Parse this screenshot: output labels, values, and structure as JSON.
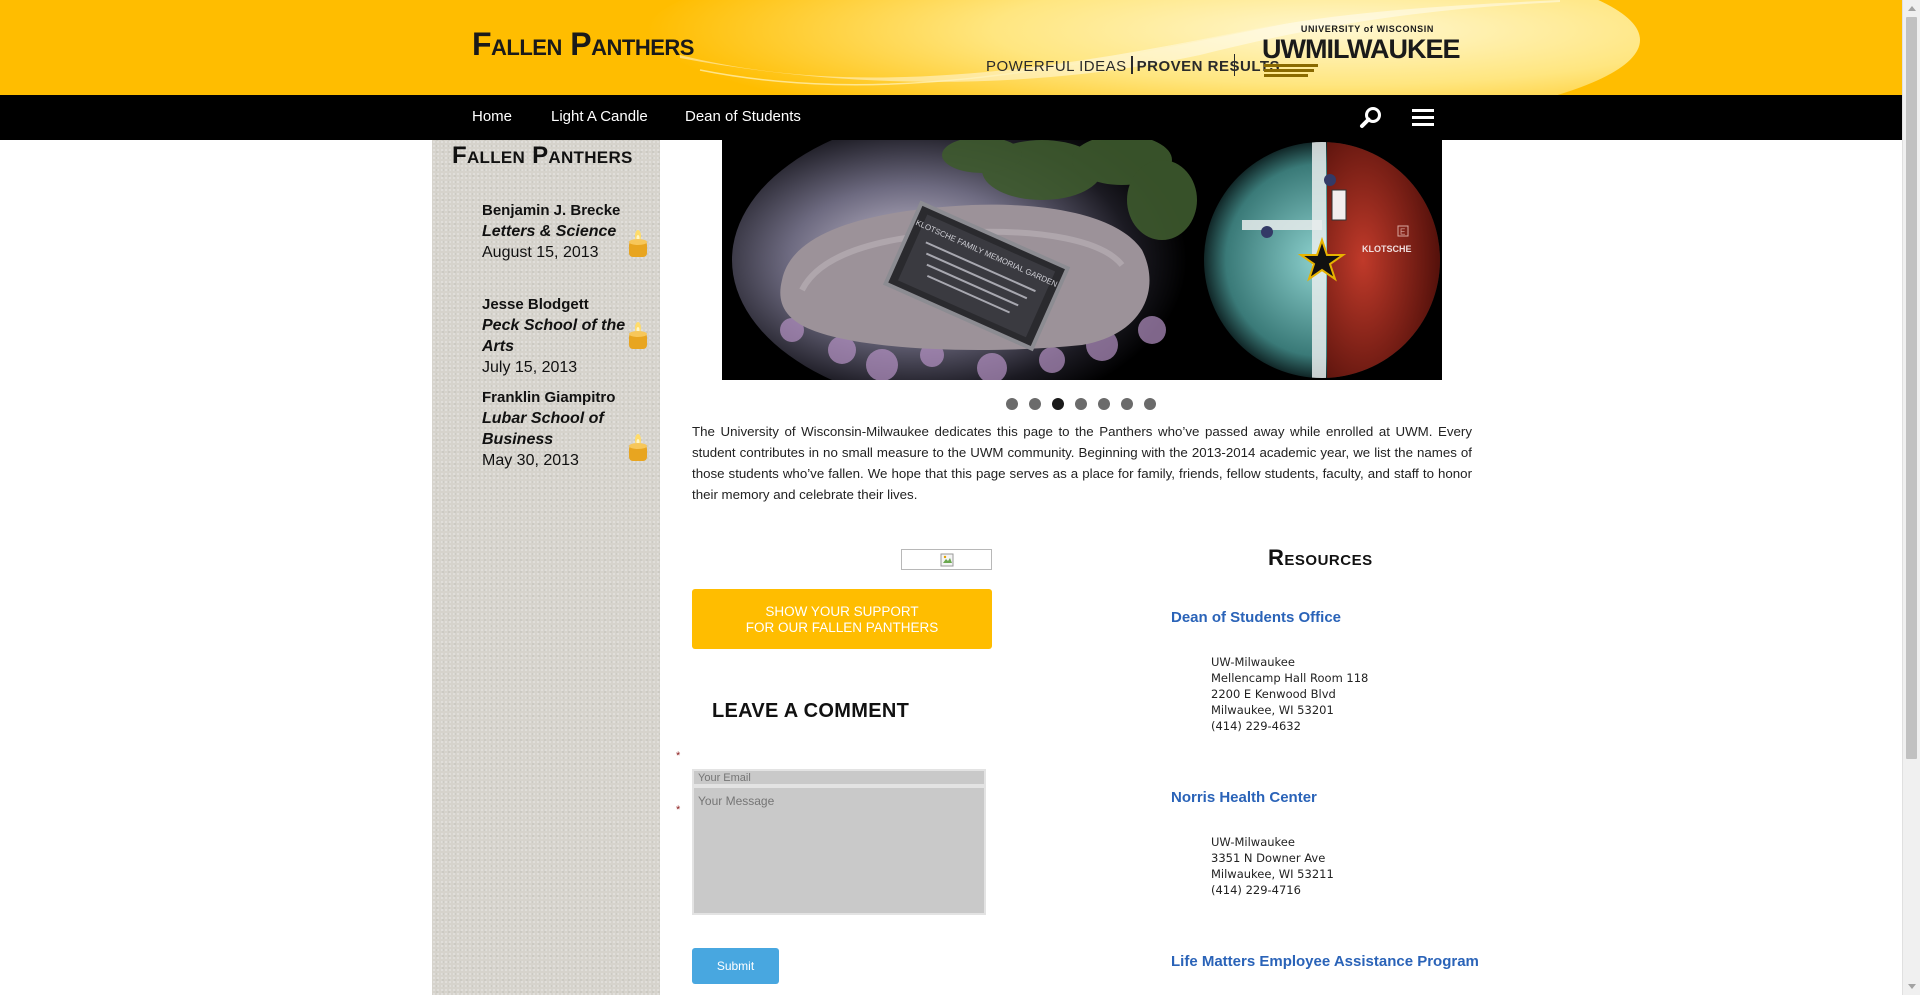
{
  "header": {
    "site_title": "Fallen Panthers",
    "tagline_light": "POWERFUL IDEAS",
    "tagline_bold": "PROVEN RESULTS",
    "logo_small": "UNIVERSITY of WISCONSIN",
    "logo_big": "UWMILWAUKEE",
    "brand_color": "#ffbd00"
  },
  "nav": {
    "items": [
      {
        "label": "Home"
      },
      {
        "label": "Light A Candle"
      },
      {
        "label": "Dean of Students"
      }
    ],
    "search_icon": "search-icon",
    "menu_icon": "hamburger-menu-icon"
  },
  "sidebar": {
    "title": "Fallen Panthers",
    "panthers": [
      {
        "name": "Benjamin J. Brecke",
        "school": "Letters & Science",
        "date": "August 15, 2013"
      },
      {
        "name": "Jesse Blodgett",
        "school": "Peck School of the Arts",
        "date": "July 15, 2013"
      },
      {
        "name": "Franklin Giampitro",
        "school": "Lubar School of Business",
        "date": "May 30, 2013"
      }
    ],
    "candle_icon": "candle-icon"
  },
  "slideshow": {
    "plaque_text": "KLOTSCHE FAMILY MEMORIAL GARDEN",
    "map_label": "KLOTSCHE",
    "map_building_letter": "E",
    "slide_count": 7,
    "active_slide": 3
  },
  "intro": "The University of Wisconsin-Milwaukee dedicates this page to the Panthers who’ve passed away while enrolled at UWM. Every student contributes in no small measure to the UWM community. Beginning with the 2013-2014 academic year, we list the names of those students who’ve fallen. We hope that this page serves as a place for family, friends, fellow students, faculty, and staff to honor their memory and celebrate their lives.",
  "support_button": {
    "line1": "Show your support",
    "line2": "for our Fallen Panthers"
  },
  "comment": {
    "title": "LEAVE A COMMENT",
    "required_mark": "*",
    "email_placeholder": "Your Email",
    "message_placeholder": "Your Message",
    "submit_label": "Submit"
  },
  "resources": {
    "title": "Resources",
    "items": [
      {
        "name": "Dean of Students Office",
        "address": [
          "UW-Milwaukee",
          "Mellencamp Hall Room 118",
          "2200 E Kenwood Blvd",
          "Milwaukee, WI 53201",
          "(414) 229-4632"
        ]
      },
      {
        "name": "Norris Health Center",
        "address": [
          "UW-Milwaukee",
          "3351 N Downer Ave",
          "Milwaukee, WI 53211",
          "(414) 229-4716"
        ]
      },
      {
        "name": "Life Matters Employee Assistance Program",
        "address": []
      }
    ],
    "link_color": "#2a63b8"
  }
}
